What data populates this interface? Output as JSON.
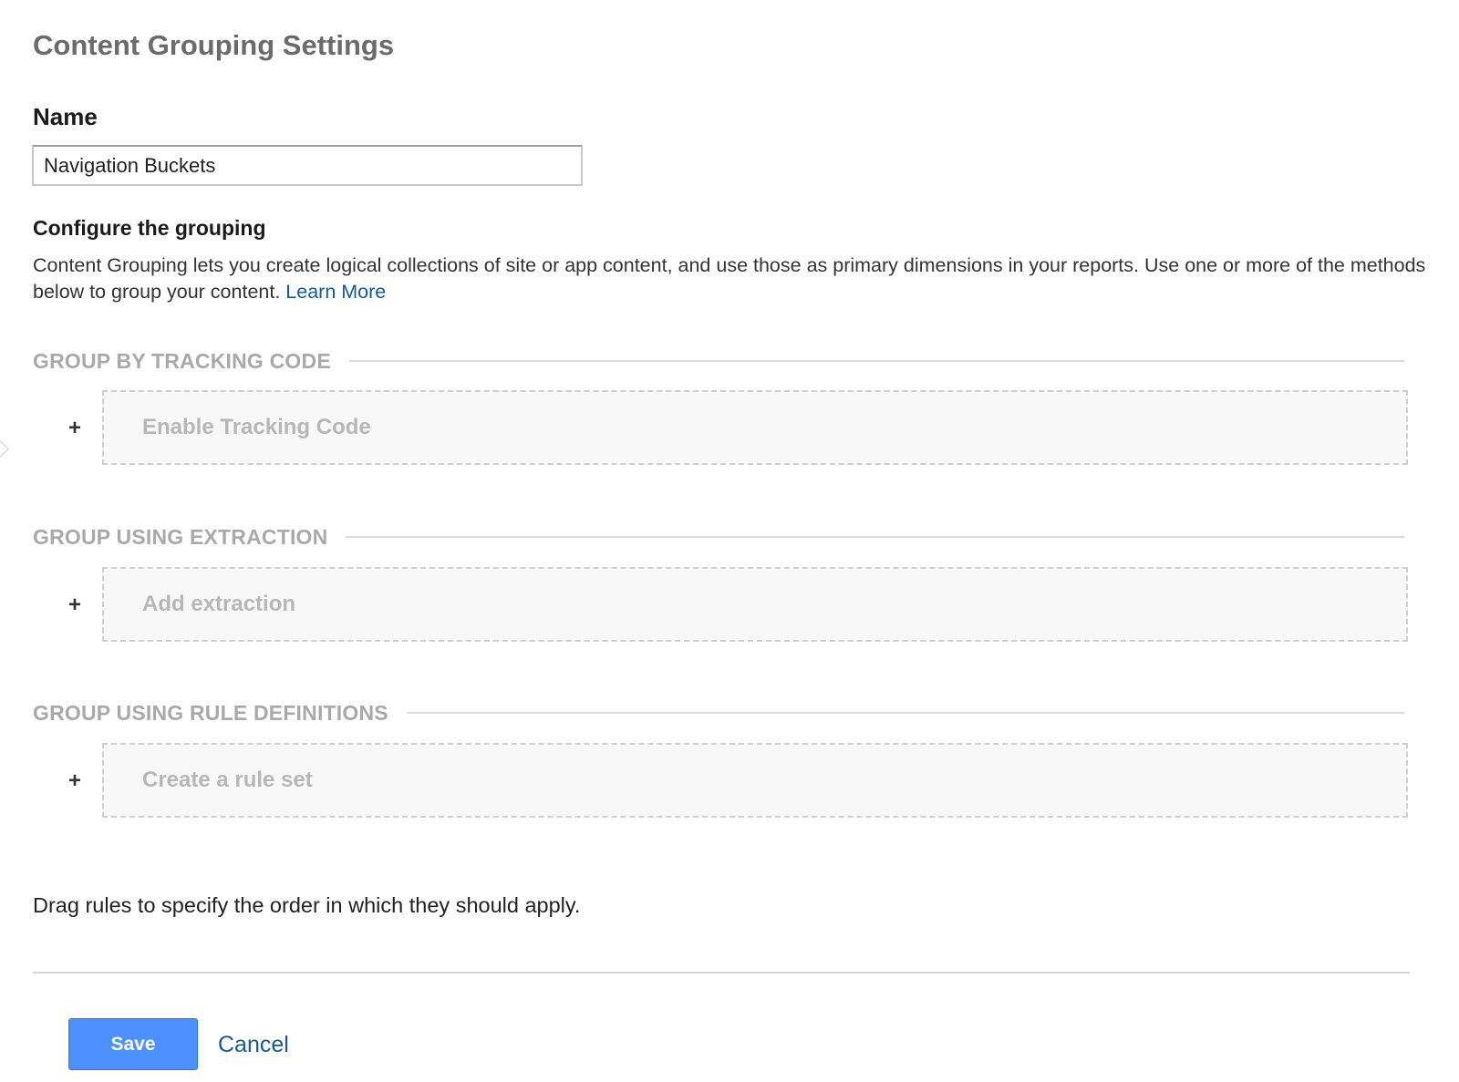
{
  "page": {
    "title": "Content Grouping Settings"
  },
  "name": {
    "label": "Name",
    "value": "Navigation Buckets"
  },
  "configure": {
    "heading": "Configure the grouping",
    "description": "Content Grouping lets you create logical collections of site or app content, and use those as primary dimensions in your reports. Use one or more of the methods below to group your content.",
    "learn_more": "Learn More"
  },
  "sections": [
    {
      "title": "GROUP BY TRACKING CODE",
      "plus": "+",
      "action": "Enable Tracking Code"
    },
    {
      "title": "GROUP USING EXTRACTION",
      "plus": "+",
      "action": "Add extraction"
    },
    {
      "title": "GROUP USING RULE DEFINITIONS",
      "plus": "+",
      "action": "Create a rule set"
    }
  ],
  "drag_note": "Drag rules to specify the order in which they should apply.",
  "footer": {
    "save_label": "Save",
    "cancel_label": "Cancel"
  },
  "colors": {
    "primary_button": "#4d90fe",
    "link": "#15599b",
    "section_title": "#a9a9a9"
  },
  "icons": {
    "add": "plus-icon",
    "side_nav": "chevron-right-icon"
  }
}
